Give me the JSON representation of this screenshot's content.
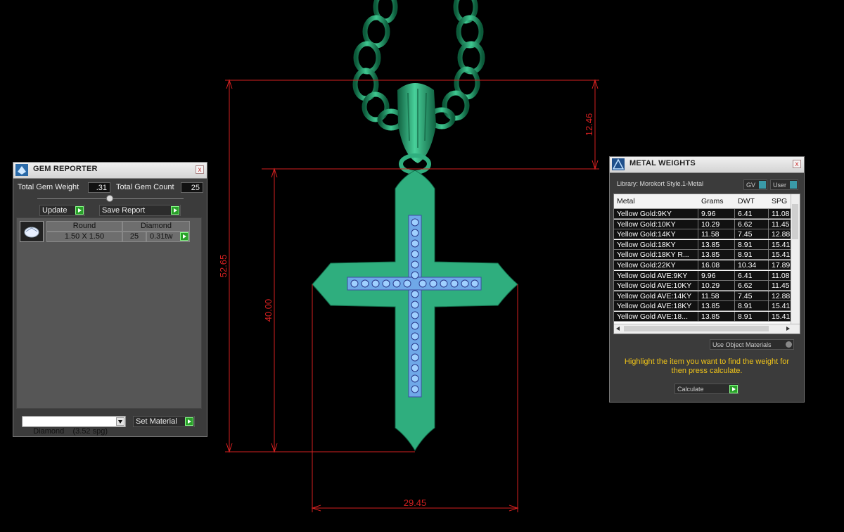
{
  "dimensions": {
    "height": "52.65",
    "top_loop": "12.46",
    "cross_height": "40.00",
    "width": "29.45"
  },
  "gem_reporter": {
    "title": "GEM REPORTER",
    "close_label": "x",
    "total_weight_label": "Total Gem Weight",
    "total_weight_value": ".31",
    "total_count_label": "Total Gem Count",
    "total_count_value": "25",
    "update_label": "Update",
    "save_report_label": "Save Report",
    "table": {
      "shape": "Round",
      "material": "Diamond",
      "size": "1.50 X 1.50",
      "count": "25",
      "weight": "0.31tw"
    },
    "material_select": "Diamond    (3.52 spg)",
    "set_material_label": "Set Material"
  },
  "metal_weights": {
    "title": "METAL WEIGHTS",
    "close_label": "x",
    "library": "Library: Morokort Style.1-Metal",
    "toggle_gv": "GV",
    "toggle_user": "User",
    "columns": [
      "Metal",
      "Grams",
      "DWT",
      "SPG"
    ],
    "rows": [
      [
        "Yellow Gold:9KY",
        "9.96",
        "6.41",
        "11.08"
      ],
      [
        "Yellow Gold:10KY",
        "10.29",
        "6.62",
        "11.45"
      ],
      [
        "Yellow Gold:14KY",
        "11.58",
        "7.45",
        "12.88"
      ],
      [
        "Yellow Gold:18KY",
        "13.85",
        "8.91",
        "15.41"
      ],
      [
        "Yellow Gold:18KY R...",
        "13.85",
        "8.91",
        "15.41"
      ],
      [
        "Yellow Gold:22KY",
        "16.08",
        "10.34",
        "17.89"
      ],
      [
        "Yellow Gold AVE:9KY",
        "9.96",
        "6.41",
        "11.08"
      ],
      [
        "Yellow Gold AVE:10KY",
        "10.29",
        "6.62",
        "11.45"
      ],
      [
        "Yellow Gold AVE:14KY",
        "11.58",
        "7.45",
        "12.88"
      ],
      [
        "Yellow Gold AVE:18KY",
        "13.85",
        "8.91",
        "15.41"
      ],
      [
        "Yellow Gold AVE:18...",
        "13.85",
        "8.91",
        "15.41"
      ]
    ],
    "use_object_materials": "Use Object Materials",
    "instruction": "Highlight the item you want to find the weight for then press calculate.",
    "calculate_label": "Calculate"
  },
  "colors": {
    "metal_green": "#2fae7e",
    "dimension_red": "#d42020",
    "gem_blue": "#7fb8f0"
  }
}
